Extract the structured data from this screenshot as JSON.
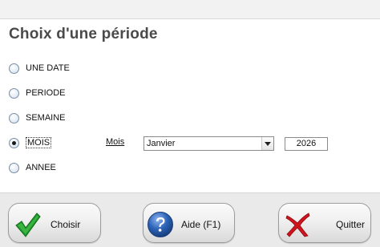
{
  "title": "Choix d'une période",
  "period_options": [
    {
      "label": "UNE DATE",
      "checked": false
    },
    {
      "label": "PERIODE",
      "checked": false
    },
    {
      "label": "SEMAINE",
      "checked": false
    },
    {
      "label": "MOIS",
      "checked": true
    },
    {
      "label": "ANNEE",
      "checked": false
    }
  ],
  "month_field": {
    "label": "Mois",
    "selected": "Janvier",
    "year": "2026"
  },
  "buttons": {
    "choisir": "Choisir",
    "aide": "Aide (F1)",
    "quitter": "Quitter"
  },
  "icons": {
    "choisir": "checkmark-icon",
    "aide": "help-icon",
    "quitter": "cross-icon"
  },
  "colors": {
    "check_green": "#1f9a2a",
    "help_blue": "#2c63b8",
    "cross_red": "#d0141d"
  }
}
